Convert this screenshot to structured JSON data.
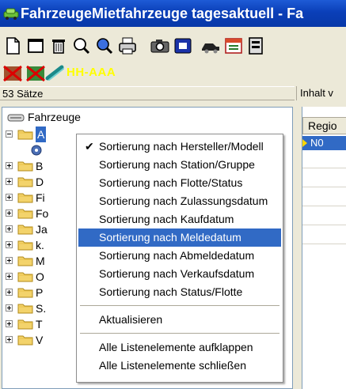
{
  "window": {
    "title": "FahrzeugeMietfahrzeuge tagesaktuell - Fa",
    "accent": "#0a3fb8"
  },
  "toolbar": {
    "icons": [
      "new-doc-icon",
      "window-icon",
      "delete-icon",
      "search-icon",
      "search-blue-icon",
      "print-icon",
      "camera-icon",
      "record-icon",
      "car-icon",
      "calendar-icon",
      "filing-icon"
    ]
  },
  "toolbar2": {
    "icons": [
      "no-entry-icon",
      "no-entry-2-icon",
      "link-icon"
    ],
    "plate": "HH-AAA"
  },
  "status": {
    "count": "53 Sätze",
    "right": "Inhalt v"
  },
  "tree": {
    "root": "Fahrzeuge",
    "nodes": [
      {
        "label": "A",
        "expanded": true,
        "selected": true
      },
      {
        "label": "B"
      },
      {
        "label": "D"
      },
      {
        "label": "Fi"
      },
      {
        "label": "Fo"
      },
      {
        "label": "Ja"
      },
      {
        "label": "k."
      },
      {
        "label": "M"
      },
      {
        "label": "O"
      },
      {
        "label": "P"
      },
      {
        "label": "S."
      },
      {
        "label": "T"
      },
      {
        "label": "V"
      }
    ]
  },
  "grid": {
    "column": "Regio",
    "row_value": "N0"
  },
  "context_menu": {
    "items": [
      {
        "label": "Sortierung nach Hersteller/Modell",
        "checked": true
      },
      {
        "label": "Sortierung nach Station/Gruppe"
      },
      {
        "label": "Sortierung nach Flotte/Status"
      },
      {
        "label": "Sortierung nach Zulassungsdatum"
      },
      {
        "label": "Sortierung nach Kaufdatum"
      },
      {
        "label": "Sortierung nach Meldedatum",
        "highlighted": true
      },
      {
        "label": "Sortierung nach Abmeldedatum"
      },
      {
        "label": "Sortierung nach Verkaufsdatum"
      },
      {
        "label": "Sortierung nach Status/Flotte"
      },
      {
        "label": "Aktualisieren"
      },
      {
        "label": "Alle Listenelemente aufklappen"
      },
      {
        "label": "Alle Listenelemente schließen"
      }
    ],
    "highlight_color": "#316ac5"
  }
}
